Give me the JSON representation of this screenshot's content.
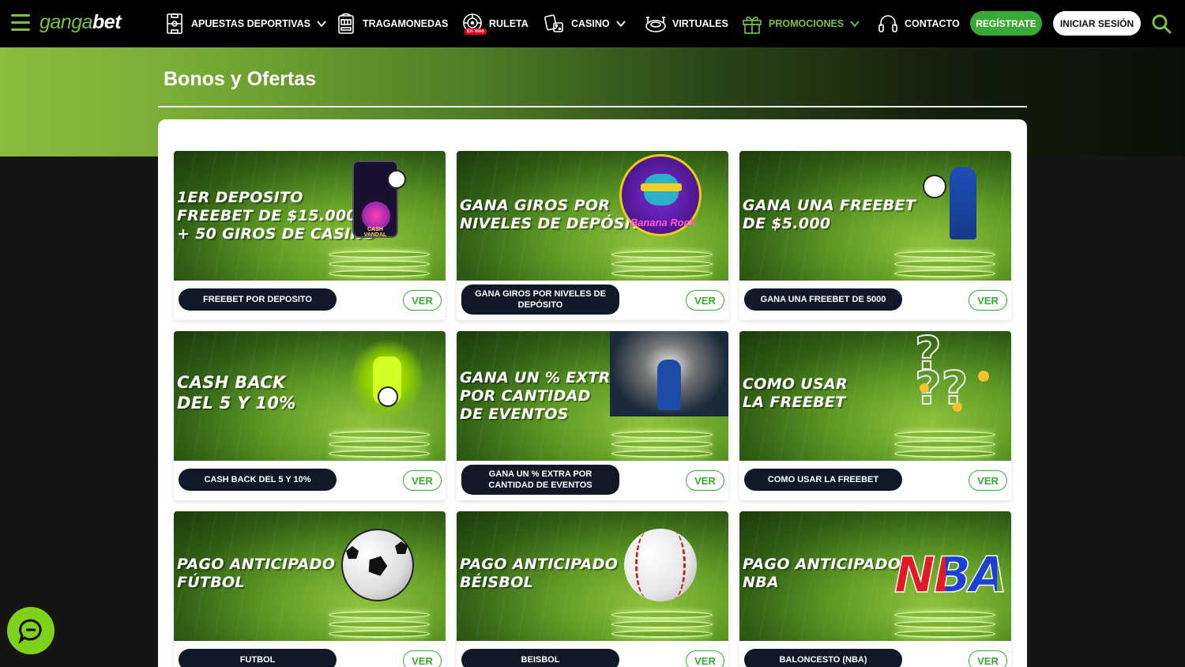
{
  "brand": {
    "logo_part1": "ganga",
    "logo_part2": "bet"
  },
  "nav": {
    "items": [
      {
        "label": "APUESTAS DEPORTIVAS",
        "icon": "sports-field-icon",
        "dropdown": true
      },
      {
        "label": "TRAGAMONEDAS",
        "icon": "slot-machine-icon",
        "dropdown": false
      },
      {
        "label": "RULETA",
        "icon": "roulette-icon",
        "badge": "En Vivo",
        "dropdown": false
      },
      {
        "label": "CASINO",
        "icon": "cards-dice-icon",
        "dropdown": true
      },
      {
        "label": "VIRTUALES",
        "icon": "virtual-stadium-icon",
        "dropdown": false
      },
      {
        "label": "PROMOCIONES",
        "icon": "gift-icon",
        "dropdown": true
      },
      {
        "label": "CONTACTO",
        "icon": "headset-icon",
        "dropdown": false
      }
    ],
    "register_label": "REGÍSTRATE",
    "login_label": "INICIAR SESIÓN"
  },
  "page": {
    "title": "Bonos y Ofertas"
  },
  "promos": [
    {
      "banner": "1er DEPOSITO\nFREEBET DE $15.000\n+ 50 GIROS DE CASINO",
      "label": "FREEBET POR DEPOSITO",
      "art_text": "CASH VANDAL",
      "button": "VER"
    },
    {
      "banner": "GANA GIROS POR\nNIVELES DE DEPÓSITO",
      "label": "GANA GIROS POR NIVELES DE DEPÓSITO",
      "art_text": "Banana Rock",
      "button": "VER"
    },
    {
      "banner": "GANA UNA FREEBET\nDE $5.000",
      "label": "GANA UNA FREEBET DE 5000",
      "button": "VER"
    },
    {
      "banner": "CASH BACK\nDEL 5 Y 10%",
      "label": "CASH BACK DEL 5 Y 10%",
      "button": "VER"
    },
    {
      "banner": "GANA UN % EXTRA\nPOR CANTIDAD\nDE EVENTOS",
      "label": "GANA UN % EXTRA POR CANTIDAD DE EVENTOS",
      "button": "VER"
    },
    {
      "banner": "COMO USAR\nLA FREEBET",
      "label": "COMO USAR LA FREEBET",
      "button": "VER"
    },
    {
      "banner": "PAGO ANTICIPADO\nFÚTBOL",
      "label": "FUTBOL",
      "button": "VER"
    },
    {
      "banner": "PAGO ANTICIPADO\nBÉISBOL",
      "label": "BEISBOL",
      "button": "VER"
    },
    {
      "banner": "PAGO ANTICIPADO\nNBA",
      "label": "BALONCESTO (NBA)",
      "art_text": "NBA",
      "button": "VER"
    }
  ],
  "colors": {
    "accent_green": "#3aa935",
    "logo_green": "#7ac143",
    "pill_dark": "#111827",
    "chat_green": "#7fd21a"
  }
}
